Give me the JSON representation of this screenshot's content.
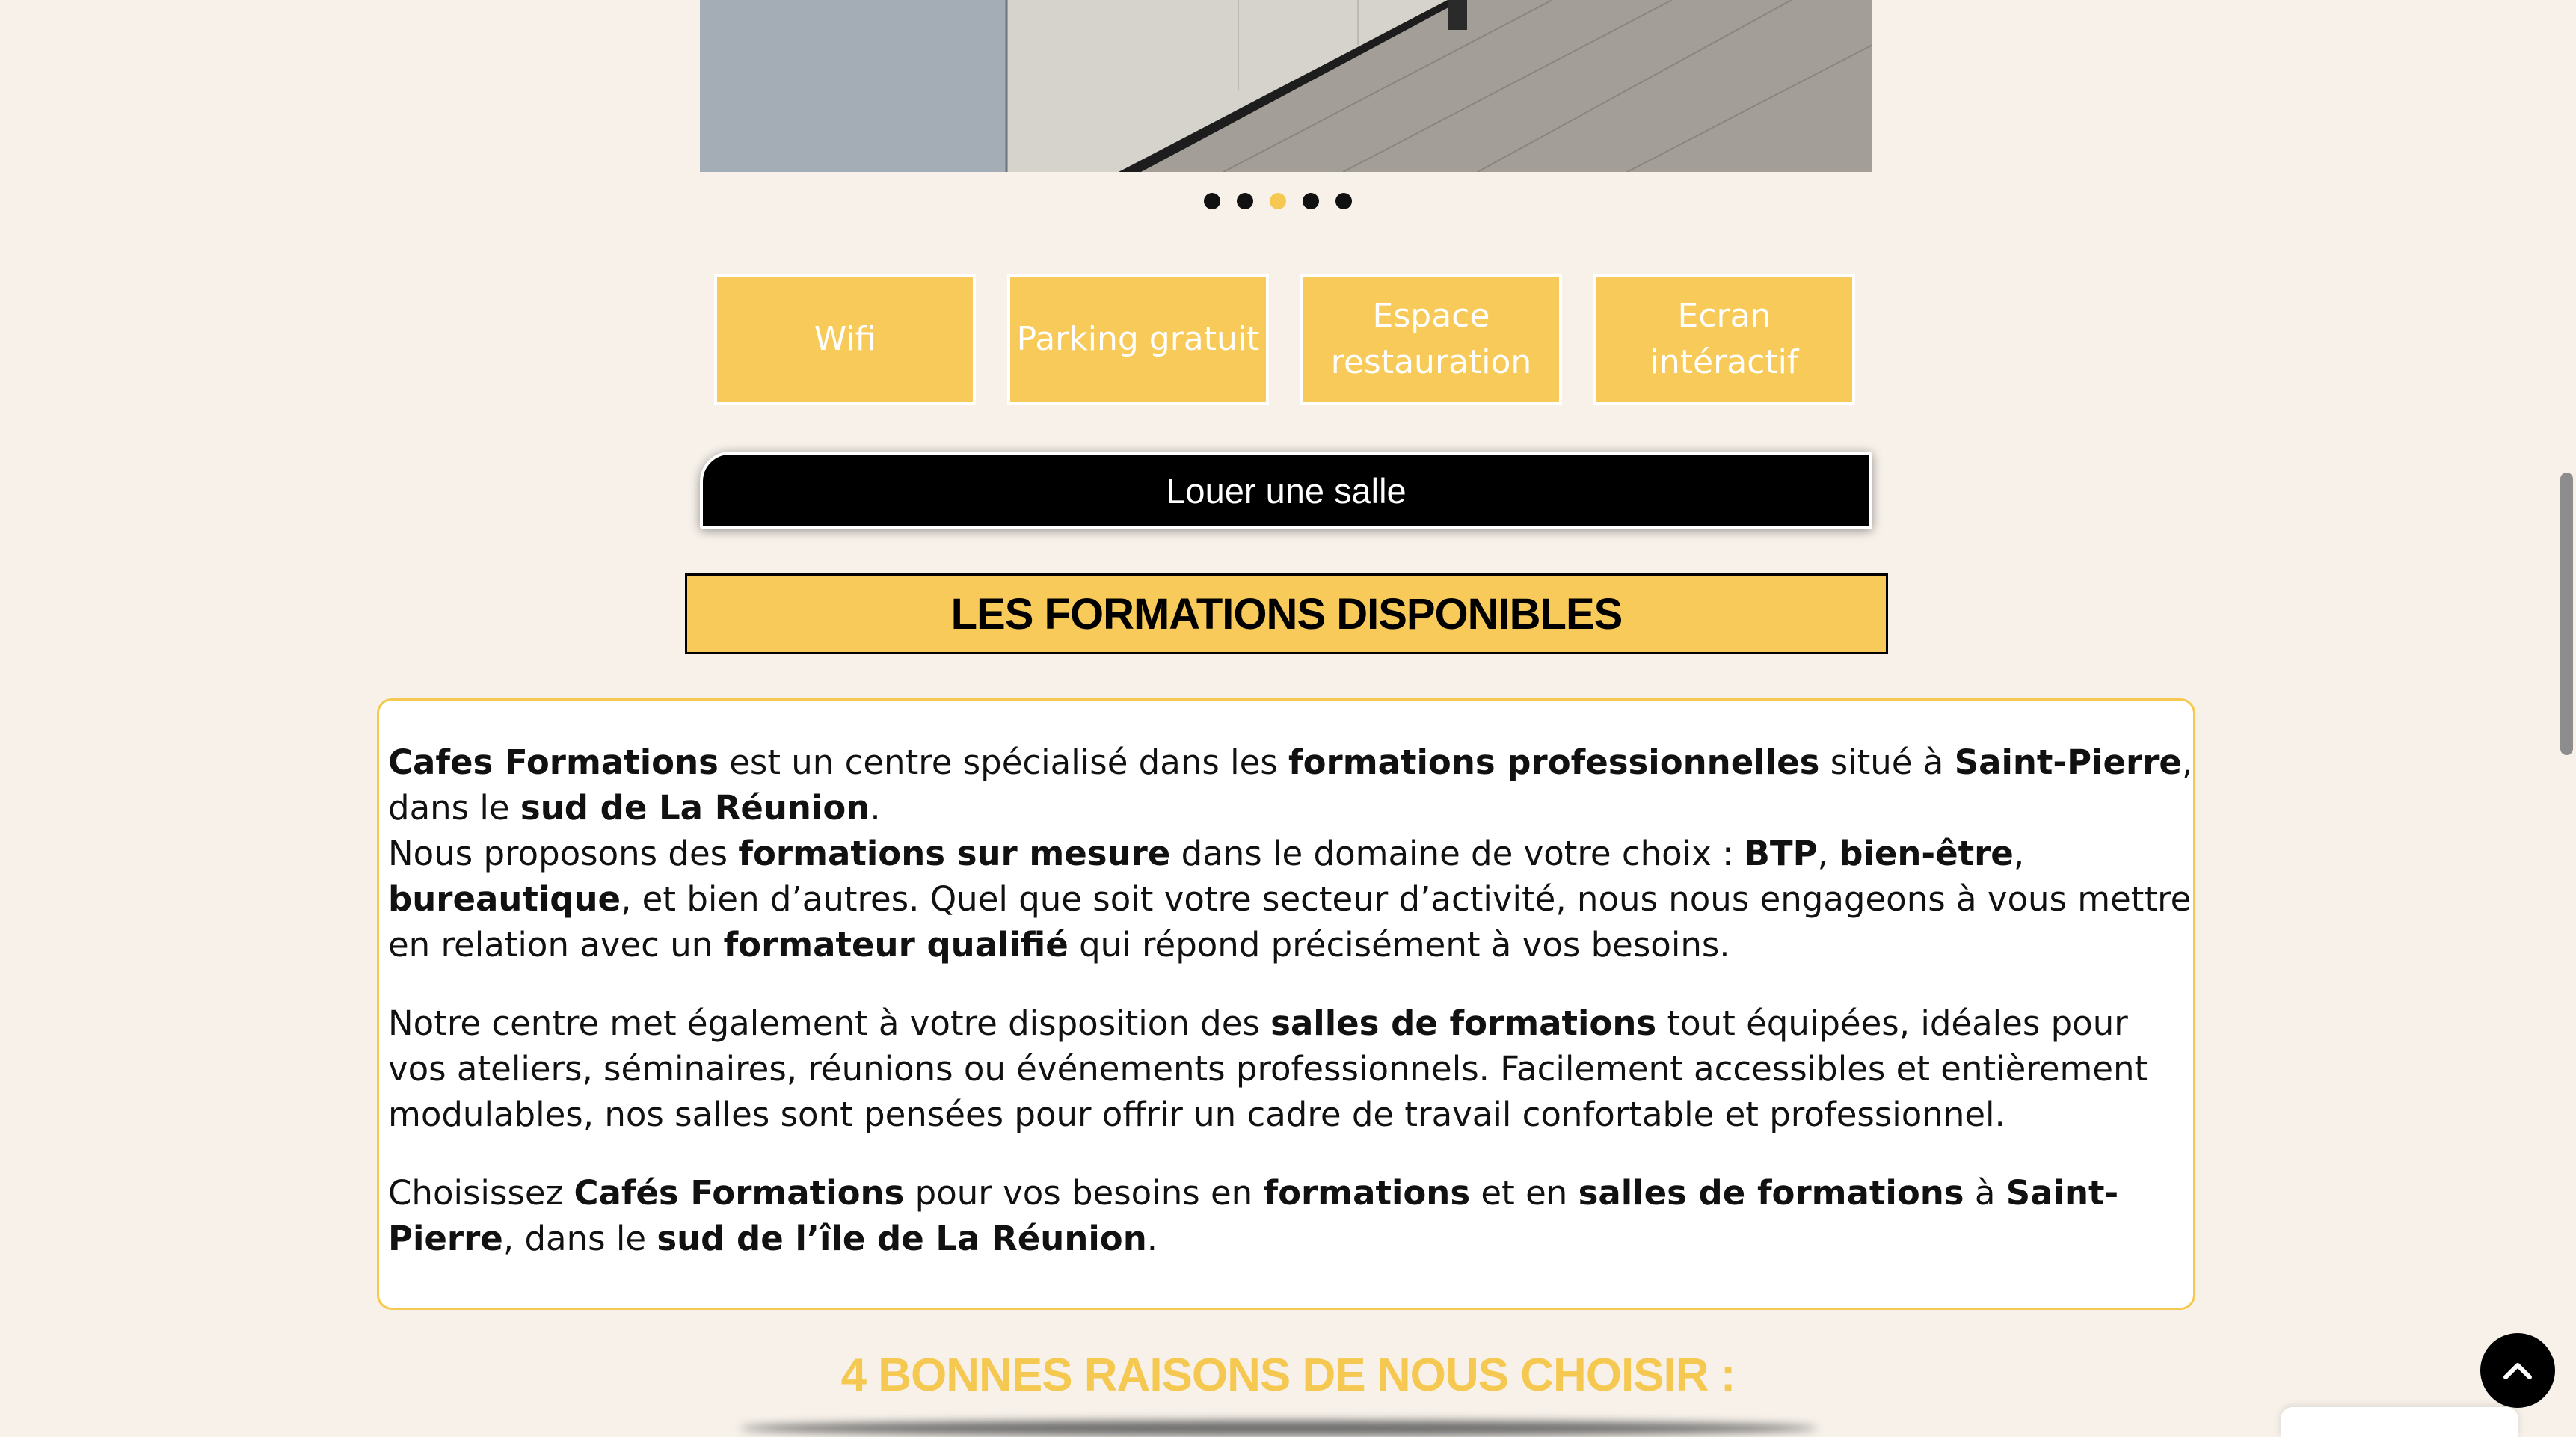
{
  "carousel": {
    "slide_count": 5,
    "active_index": 2,
    "colors": {
      "dot": "#111111",
      "dot_active": "#f5c951"
    }
  },
  "features": [
    {
      "label": "Wifi"
    },
    {
      "label": "Parking gratuit"
    },
    {
      "label": "Espace restauration"
    },
    {
      "label": "Ecran intéractif"
    }
  ],
  "rent_button": {
    "label": "Louer une salle"
  },
  "section_title": "LES FORMATIONS DISPONIBLES",
  "intro": {
    "p1": [
      {
        "text": "Cafes Formations",
        "bold": true
      },
      {
        "text": " est un centre spécialisé dans les ",
        "bold": false
      },
      {
        "text": "formations professionnelles",
        "bold": true
      },
      {
        "text": " situé à ",
        "bold": false
      },
      {
        "text": "Saint-Pierre",
        "bold": true
      },
      {
        "text": ", dans le ",
        "bold": false
      },
      {
        "text": "sud de La Réunion",
        "bold": true
      },
      {
        "text": ".",
        "bold": false
      },
      {
        "br": true
      },
      {
        "text": "Nous proposons des ",
        "bold": false
      },
      {
        "text": "formations sur mesure",
        "bold": true
      },
      {
        "text": " dans le domaine de votre choix : ",
        "bold": false
      },
      {
        "text": "BTP",
        "bold": true
      },
      {
        "text": ", ",
        "bold": false
      },
      {
        "text": "bien-être",
        "bold": true
      },
      {
        "text": ", ",
        "bold": false
      },
      {
        "text": "bureautique",
        "bold": true
      },
      {
        "text": ", et bien d’autres. Quel que soit votre secteur d’activité, nous nous engageons à vous mettre en relation avec un ",
        "bold": false
      },
      {
        "text": "formateur qualifié",
        "bold": true
      },
      {
        "text": " qui répond précisément à vos besoins.",
        "bold": false
      }
    ],
    "p2": [
      {
        "text": "Notre centre met également à votre disposition des ",
        "bold": false
      },
      {
        "text": "salles de formations",
        "bold": true
      },
      {
        "text": " tout équipées, idéales pour vos ateliers, séminaires, réunions ou événements professionnels. Facilement accessibles et entièrement modulables, nos salles sont pensées pour offrir un cadre de travail confortable et professionnel.",
        "bold": false
      }
    ],
    "p3": [
      {
        "text": "Choisissez ",
        "bold": false
      },
      {
        "text": "Cafés Formations",
        "bold": true
      },
      {
        "text": " pour vos besoins en ",
        "bold": false
      },
      {
        "text": "formations",
        "bold": true
      },
      {
        "text": " et en ",
        "bold": false
      },
      {
        "text": "salles de formations",
        "bold": true
      },
      {
        "text": " à ",
        "bold": false
      },
      {
        "text": "Saint-Pierre",
        "bold": true
      },
      {
        "text": ", dans le ",
        "bold": false
      },
      {
        "text": "sud de l’île de La Réunion",
        "bold": true
      },
      {
        "text": ".",
        "bold": false
      }
    ]
  },
  "reasons_title": "4 BONNES RAISONS DE NOUS CHOISIR :",
  "back_to_top": {
    "icon": "chevron-up-icon"
  },
  "theme": {
    "background": "#f7f1ea",
    "accent": "#f7ca5a",
    "accent_text": "#f5c951",
    "dark": "#000000"
  }
}
